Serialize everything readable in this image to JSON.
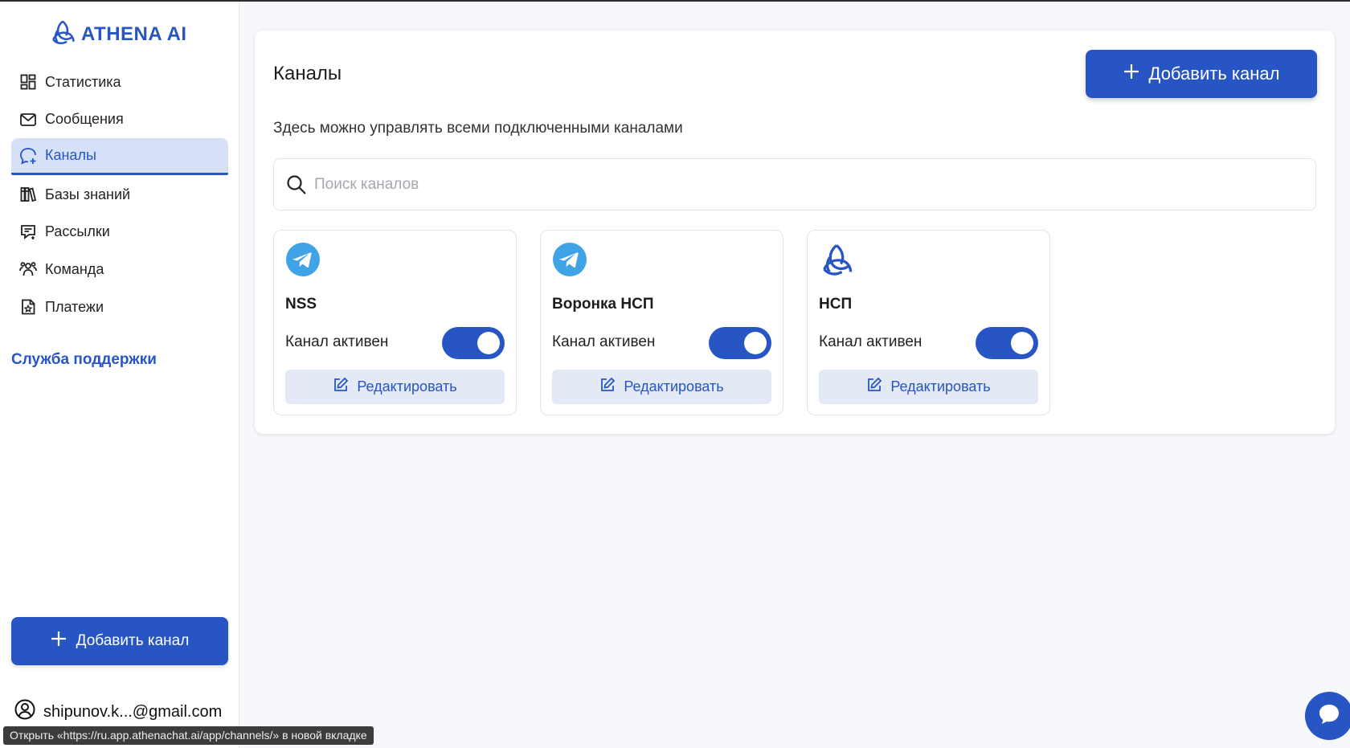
{
  "app": {
    "logo_text": "ATHENA AI",
    "accent_color": "#2756c4"
  },
  "sidebar": {
    "items": [
      {
        "label": "Статистика",
        "icon": "dashboard-grid-icon"
      },
      {
        "label": "Сообщения",
        "icon": "mail-icon"
      },
      {
        "label": "Каналы",
        "icon": "channels-chat-icon",
        "active": true
      },
      {
        "label": "Базы знаний",
        "icon": "books-icon"
      },
      {
        "label": "Рассылки",
        "icon": "broadcast-icon"
      },
      {
        "label": "Команда",
        "icon": "team-icon"
      },
      {
        "label": "Платежи",
        "icon": "payments-icon"
      }
    ],
    "support_label": "Служба поддержки",
    "add_channel_label": "Добавить канал",
    "user_email": "shipunov.k...@gmail.com"
  },
  "main": {
    "title": "Каналы",
    "add_channel_label": "Добавить канал",
    "description": "Здесь можно управлять всеми подключенными каналами",
    "search": {
      "placeholder": "Поиск каналов",
      "value": ""
    },
    "channels": [
      {
        "name": "NSS",
        "icon": "telegram-icon",
        "status_label": "Канал активен",
        "active": true,
        "edit_label": "Редактировать"
      },
      {
        "name": "Воронка НСП",
        "icon": "telegram-icon",
        "status_label": "Канал активен",
        "active": true,
        "edit_label": "Редактировать"
      },
      {
        "name": "НСП",
        "icon": "athena-logo-icon",
        "status_label": "Канал активен",
        "active": true,
        "edit_label": "Редактировать"
      }
    ]
  },
  "status_bar": {
    "tooltip": "Открыть «https://ru.app.athenachat.ai/app/channels/» в новой вкладке"
  }
}
